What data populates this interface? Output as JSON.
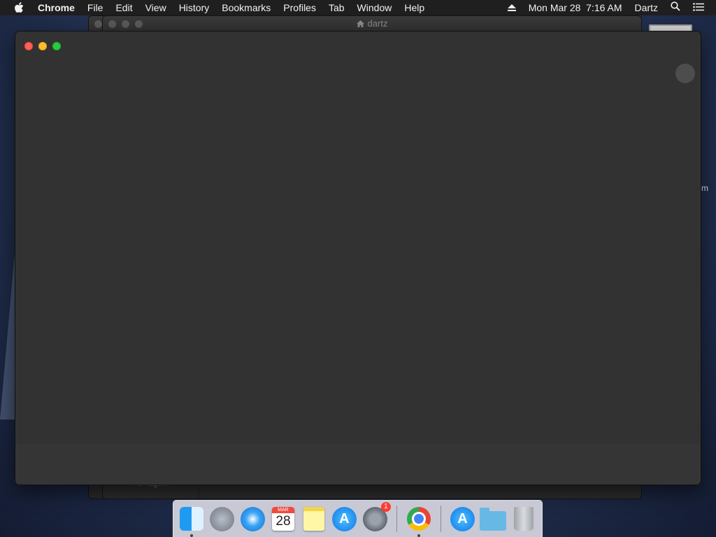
{
  "menubar": {
    "app_name": "Chrome",
    "items": [
      "File",
      "Edit",
      "View",
      "History",
      "Bookmarks",
      "Profiles",
      "Tab",
      "Window",
      "Help"
    ],
    "clock": "Mon Mar 28  7:16 AM",
    "user": "Dartz"
  },
  "background_window": {
    "title": "dartz",
    "bottom_label": "All Tags..."
  },
  "desktop": {
    "right_label": "m"
  },
  "dock": {
    "calendar_month": "MAR",
    "calendar_day": "28",
    "prefs_badge": "1",
    "appstore_glyph": "A"
  },
  "colors": {
    "close": "#fe5f57",
    "minimize": "#febc2e",
    "maximize": "#28c840",
    "window_bg": "#323232"
  }
}
